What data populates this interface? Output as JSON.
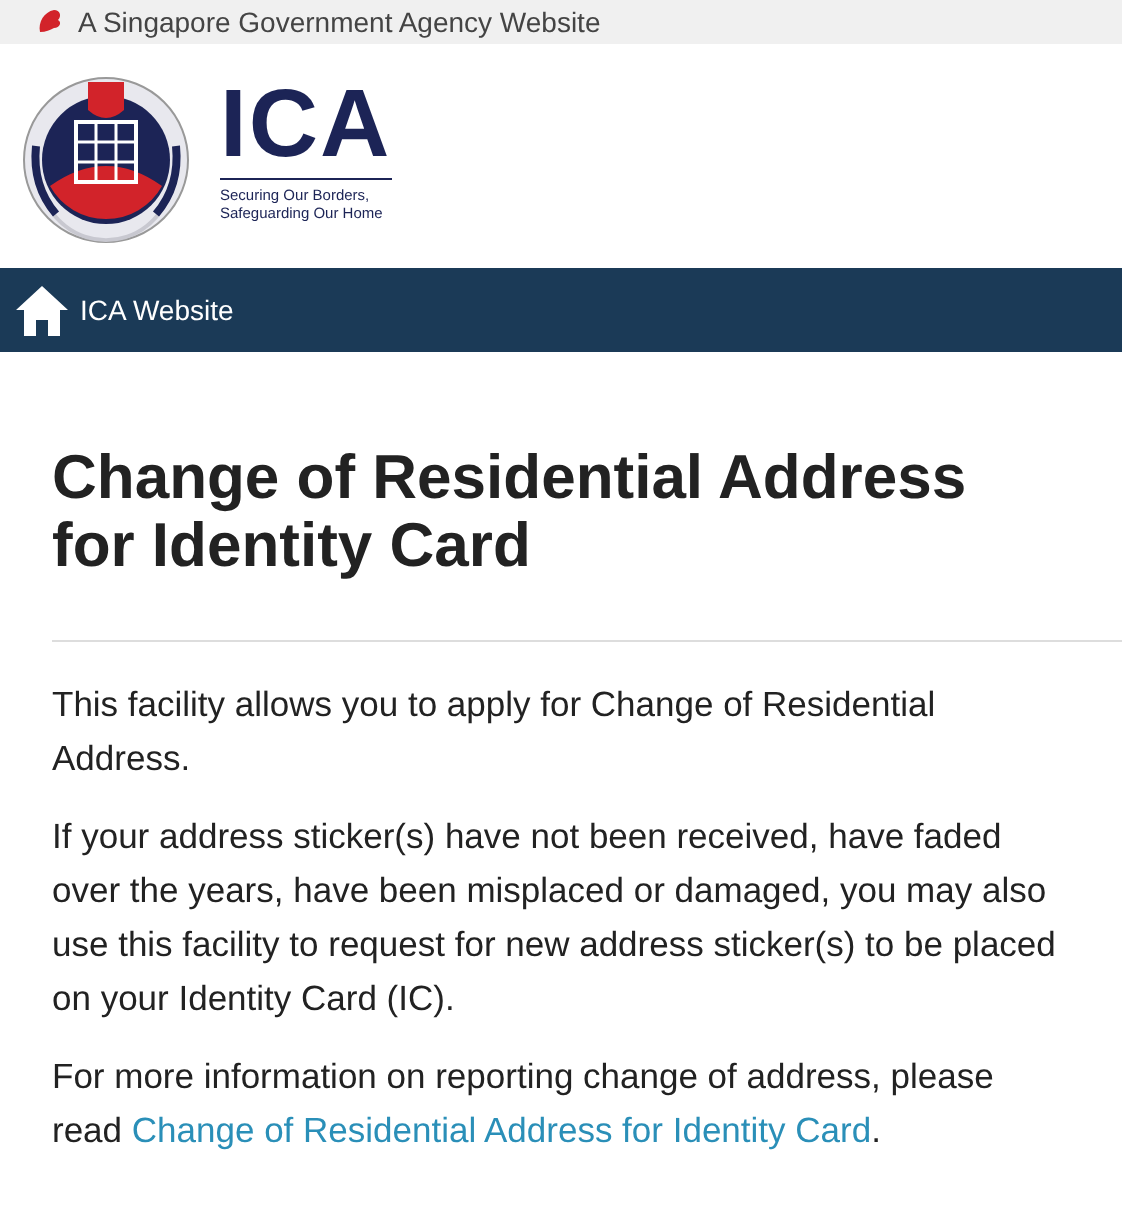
{
  "gov_bar": {
    "text": "A Singapore Government Agency Website"
  },
  "logo": {
    "name": "ICA",
    "tagline_lines": [
      "Securing Our Borders,",
      "Safeguarding Our Home"
    ]
  },
  "nav": {
    "home_link": "ICA Website"
  },
  "heading": "Change of Residential Address for Identity Card",
  "paragraphs": [
    {
      "text": "This facility allows you to apply for Change of Residential Address."
    },
    {
      "text": "If your address sticker(s) have not been received, have faded over the years, have been misplaced or damaged, you may also use this facility to request for new address sticker(s) to be placed on your Identity Card (IC)."
    },
    {
      "text": "For more information on reporting change of address, please read",
      "link": "Change of Residential Address for Identity Card",
      "after": "."
    }
  ]
}
